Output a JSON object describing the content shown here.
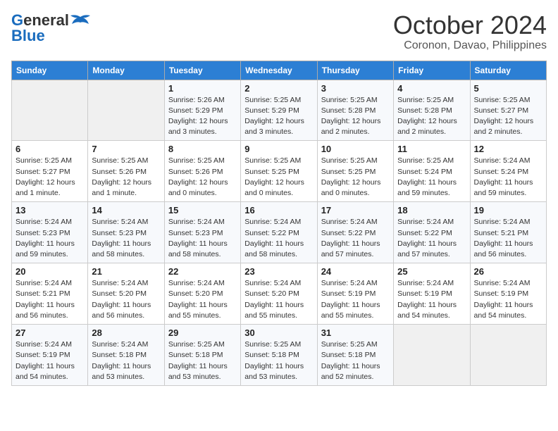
{
  "header": {
    "logo_general": "General",
    "logo_blue": "Blue",
    "month_title": "October 2024",
    "subtitle": "Coronon, Davao, Philippines"
  },
  "calendar": {
    "days_of_week": [
      "Sunday",
      "Monday",
      "Tuesday",
      "Wednesday",
      "Thursday",
      "Friday",
      "Saturday"
    ],
    "weeks": [
      [
        {
          "day": "",
          "info": ""
        },
        {
          "day": "",
          "info": ""
        },
        {
          "day": "1",
          "info": "Sunrise: 5:26 AM\nSunset: 5:29 PM\nDaylight: 12 hours and 3 minutes."
        },
        {
          "day": "2",
          "info": "Sunrise: 5:25 AM\nSunset: 5:29 PM\nDaylight: 12 hours and 3 minutes."
        },
        {
          "day": "3",
          "info": "Sunrise: 5:25 AM\nSunset: 5:28 PM\nDaylight: 12 hours and 2 minutes."
        },
        {
          "day": "4",
          "info": "Sunrise: 5:25 AM\nSunset: 5:28 PM\nDaylight: 12 hours and 2 minutes."
        },
        {
          "day": "5",
          "info": "Sunrise: 5:25 AM\nSunset: 5:27 PM\nDaylight: 12 hours and 2 minutes."
        }
      ],
      [
        {
          "day": "6",
          "info": "Sunrise: 5:25 AM\nSunset: 5:27 PM\nDaylight: 12 hours and 1 minute."
        },
        {
          "day": "7",
          "info": "Sunrise: 5:25 AM\nSunset: 5:26 PM\nDaylight: 12 hours and 1 minute."
        },
        {
          "day": "8",
          "info": "Sunrise: 5:25 AM\nSunset: 5:26 PM\nDaylight: 12 hours and 0 minutes."
        },
        {
          "day": "9",
          "info": "Sunrise: 5:25 AM\nSunset: 5:25 PM\nDaylight: 12 hours and 0 minutes."
        },
        {
          "day": "10",
          "info": "Sunrise: 5:25 AM\nSunset: 5:25 PM\nDaylight: 12 hours and 0 minutes."
        },
        {
          "day": "11",
          "info": "Sunrise: 5:25 AM\nSunset: 5:24 PM\nDaylight: 11 hours and 59 minutes."
        },
        {
          "day": "12",
          "info": "Sunrise: 5:24 AM\nSunset: 5:24 PM\nDaylight: 11 hours and 59 minutes."
        }
      ],
      [
        {
          "day": "13",
          "info": "Sunrise: 5:24 AM\nSunset: 5:23 PM\nDaylight: 11 hours and 59 minutes."
        },
        {
          "day": "14",
          "info": "Sunrise: 5:24 AM\nSunset: 5:23 PM\nDaylight: 11 hours and 58 minutes."
        },
        {
          "day": "15",
          "info": "Sunrise: 5:24 AM\nSunset: 5:23 PM\nDaylight: 11 hours and 58 minutes."
        },
        {
          "day": "16",
          "info": "Sunrise: 5:24 AM\nSunset: 5:22 PM\nDaylight: 11 hours and 58 minutes."
        },
        {
          "day": "17",
          "info": "Sunrise: 5:24 AM\nSunset: 5:22 PM\nDaylight: 11 hours and 57 minutes."
        },
        {
          "day": "18",
          "info": "Sunrise: 5:24 AM\nSunset: 5:22 PM\nDaylight: 11 hours and 57 minutes."
        },
        {
          "day": "19",
          "info": "Sunrise: 5:24 AM\nSunset: 5:21 PM\nDaylight: 11 hours and 56 minutes."
        }
      ],
      [
        {
          "day": "20",
          "info": "Sunrise: 5:24 AM\nSunset: 5:21 PM\nDaylight: 11 hours and 56 minutes."
        },
        {
          "day": "21",
          "info": "Sunrise: 5:24 AM\nSunset: 5:20 PM\nDaylight: 11 hours and 56 minutes."
        },
        {
          "day": "22",
          "info": "Sunrise: 5:24 AM\nSunset: 5:20 PM\nDaylight: 11 hours and 55 minutes."
        },
        {
          "day": "23",
          "info": "Sunrise: 5:24 AM\nSunset: 5:20 PM\nDaylight: 11 hours and 55 minutes."
        },
        {
          "day": "24",
          "info": "Sunrise: 5:24 AM\nSunset: 5:19 PM\nDaylight: 11 hours and 55 minutes."
        },
        {
          "day": "25",
          "info": "Sunrise: 5:24 AM\nSunset: 5:19 PM\nDaylight: 11 hours and 54 minutes."
        },
        {
          "day": "26",
          "info": "Sunrise: 5:24 AM\nSunset: 5:19 PM\nDaylight: 11 hours and 54 minutes."
        }
      ],
      [
        {
          "day": "27",
          "info": "Sunrise: 5:24 AM\nSunset: 5:19 PM\nDaylight: 11 hours and 54 minutes."
        },
        {
          "day": "28",
          "info": "Sunrise: 5:24 AM\nSunset: 5:18 PM\nDaylight: 11 hours and 53 minutes."
        },
        {
          "day": "29",
          "info": "Sunrise: 5:25 AM\nSunset: 5:18 PM\nDaylight: 11 hours and 53 minutes."
        },
        {
          "day": "30",
          "info": "Sunrise: 5:25 AM\nSunset: 5:18 PM\nDaylight: 11 hours and 53 minutes."
        },
        {
          "day": "31",
          "info": "Sunrise: 5:25 AM\nSunset: 5:18 PM\nDaylight: 11 hours and 52 minutes."
        },
        {
          "day": "",
          "info": ""
        },
        {
          "day": "",
          "info": ""
        }
      ]
    ]
  }
}
